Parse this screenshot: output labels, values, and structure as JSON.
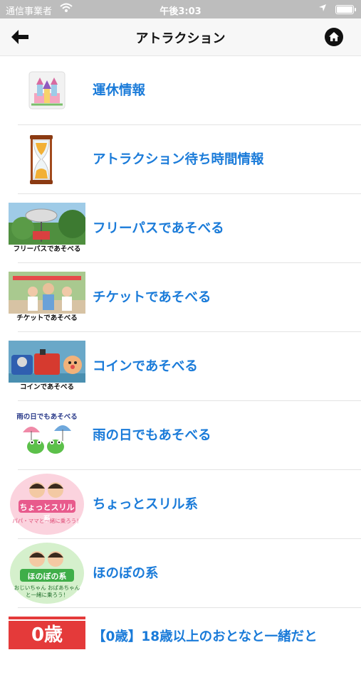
{
  "status": {
    "carrier": "通信事業者",
    "time": "午後3:03",
    "battery_level": 1.0
  },
  "nav": {
    "back_icon": "arrow-left-icon",
    "title": "アトラクション",
    "home_icon": "home-icon"
  },
  "items": [
    {
      "label": "運休情報",
      "thumb_icon": "castle-icon",
      "caption": ""
    },
    {
      "label": "アトラクション待ち時間情報",
      "thumb_icon": "hourglass-icon",
      "caption": ""
    },
    {
      "label": "フリーパスであそべる",
      "thumb_icon": "zeppelin-ride-photo",
      "caption": "フリーパスであそべる"
    },
    {
      "label": "チケットであそべる",
      "thumb_icon": "family-photo",
      "caption": "チケットであそべる"
    },
    {
      "label": "コインであそべる",
      "thumb_icon": "coin-ride-photo",
      "caption": "コインであそべる"
    },
    {
      "label": "雨の日でもあそべる",
      "thumb_icon": "rain-frogs-icon",
      "caption": "雨の日でもあそべる"
    },
    {
      "label": "ちょっとスリル系",
      "thumb_icon": "thrill-kids-icon",
      "caption": "ちょっとスリル系",
      "sub": "パパ・ママと一緒に乗ろう！"
    },
    {
      "label": "ほのぼの系",
      "thumb_icon": "gentle-kids-icon",
      "caption": "ほのぼの系",
      "sub": "おじいちゃん おばあちゃんと一緒に乗ろう！"
    },
    {
      "label": "【0歳】18歳以上のおとなと一緒だと",
      "thumb_icon": "age-zero-badge",
      "caption": "0歳"
    }
  ]
}
